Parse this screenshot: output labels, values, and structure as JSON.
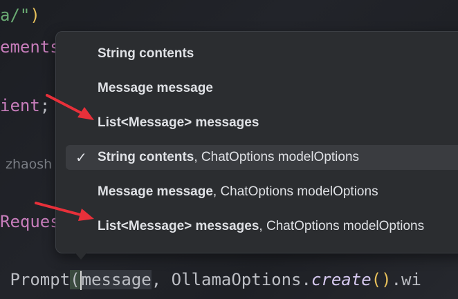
{
  "code": {
    "line1_string": "a/\"",
    "line1_paren": ")",
    "line2": "ements",
    "line3_name": "ient",
    "line3_semi": ";",
    "line4_author": "zhaosh",
    "line5": "Reques",
    "bottom_prefix": " Prompt",
    "bottom_paren": "(",
    "bottom_arg": "message",
    "bottom_rest": ", OllamaOptions.",
    "bottom_method": "create",
    "bottom_call": "()",
    "bottom_tail": ".wi"
  },
  "popup": {
    "items": [
      {
        "bold": "String contents",
        "plain": "",
        "selected": false
      },
      {
        "bold": "Message message",
        "plain": "",
        "selected": false
      },
      {
        "bold": "List<Message> messages",
        "plain": "",
        "selected": false
      },
      {
        "bold": "String contents",
        "plain": ", ChatOptions modelOptions",
        "selected": true
      },
      {
        "bold": "Message message",
        "plain": ", ChatOptions modelOptions",
        "selected": false
      },
      {
        "bold": "List<Message> messages",
        "plain": ", ChatOptions modelOptions",
        "selected": false
      }
    ],
    "check_glyph": "✓"
  },
  "annotations": {
    "arrow_color": "#e8303a"
  }
}
